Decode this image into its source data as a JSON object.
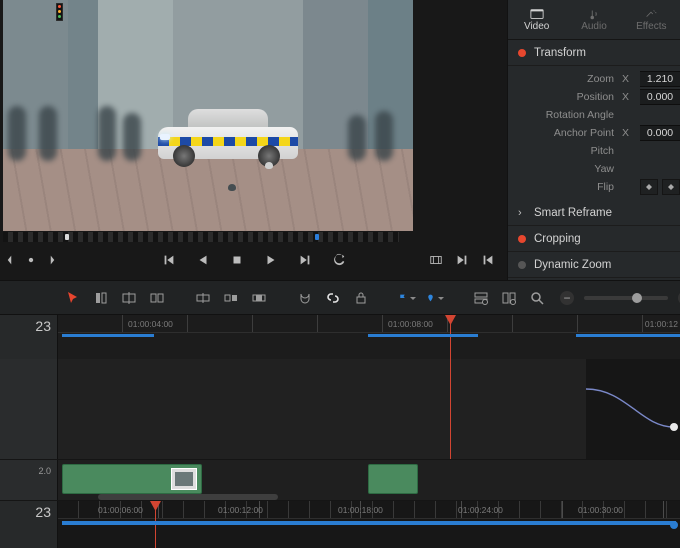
{
  "inspector": {
    "tabs": {
      "video": "Video",
      "audio": "Audio",
      "effects": "Effects"
    },
    "transform": {
      "label": "Transform",
      "zoom_label": "Zoom",
      "zoom_axis": "X",
      "zoom_val": "1.210",
      "pos_label": "Position",
      "pos_axis": "X",
      "pos_val": "0.000",
      "rot_label": "Rotation Angle",
      "anchor_label": "Anchor Point",
      "anchor_axis": "X",
      "anchor_val": "0.000",
      "pitch_label": "Pitch",
      "yaw_label": "Yaw",
      "flip_label": "Flip"
    },
    "smart_reframe": "Smart Reframe",
    "cropping": "Cropping",
    "dynamic_zoom": "Dynamic Zoom"
  },
  "ruler_upper": {
    "track_label": "23",
    "tc": [
      "01:00:04:00",
      "01:00:08:00",
      "01:00:12"
    ]
  },
  "track_strip": {
    "label": "2.0"
  },
  "ruler_lower": {
    "track_label": "23",
    "tc": [
      "01:00:06:00",
      "01:00:12:00",
      "01:00:18:00",
      "01:00:24:00",
      "01:00:30:00"
    ]
  }
}
